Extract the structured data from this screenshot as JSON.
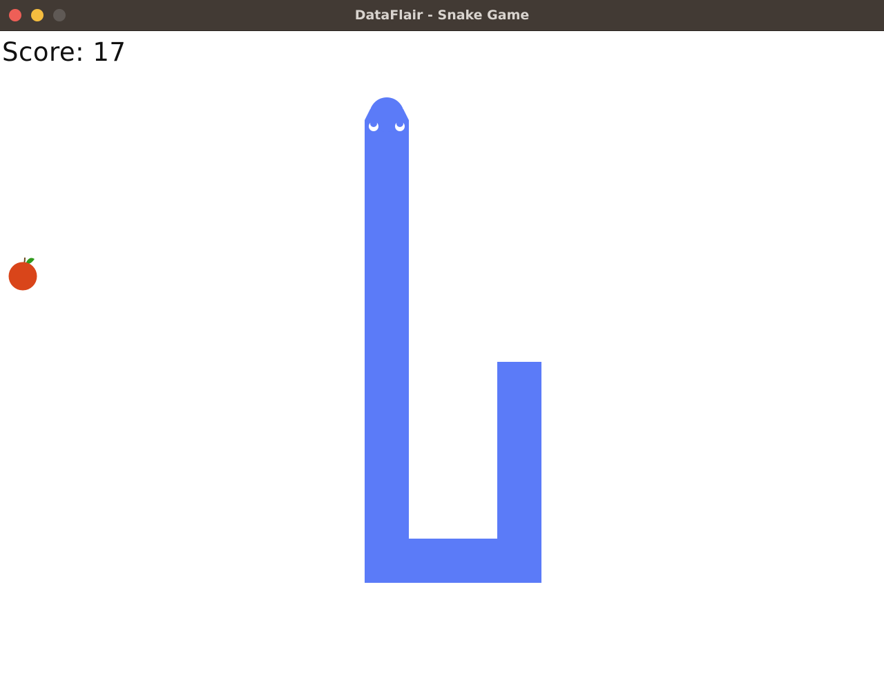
{
  "window": {
    "title": "DataFlair - Snake Game",
    "titlebar_color": "#423a34",
    "buttons": {
      "close_color": "#ee5f57",
      "minimize_color": "#f5bd3f",
      "zoom_color": "#5f5955"
    }
  },
  "game": {
    "score_label": "Score: 17",
    "background_color": "#ffffff",
    "snake": {
      "color": "#5b7bf8",
      "heading": "up",
      "eye_color": "#ffffff"
    },
    "food": {
      "kind": "apple",
      "color": "#d9451a",
      "leaf_color": "#2f9a1c"
    }
  }
}
